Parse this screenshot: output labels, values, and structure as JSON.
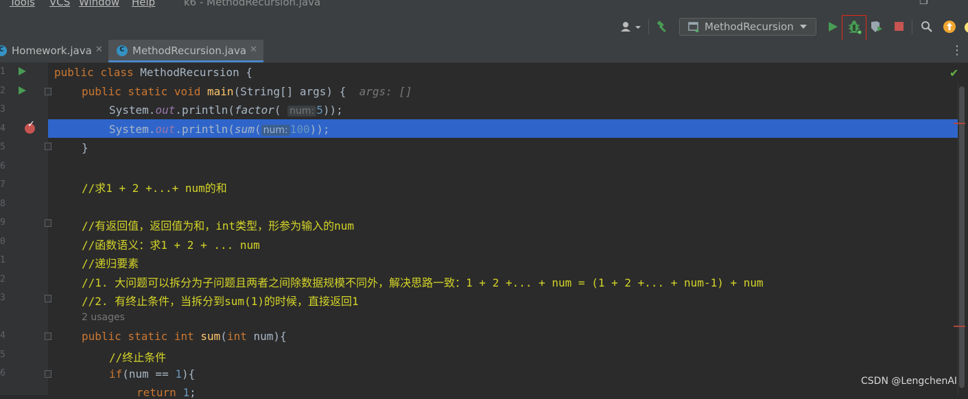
{
  "menubar": {
    "items": [
      "Tools",
      "VCS",
      "Window",
      "Help"
    ],
    "title": "k6 - MethodRecursion.java"
  },
  "toolbar": {
    "run_config": "MethodRecursion",
    "icons": [
      "user-icon",
      "build-hammer-icon",
      "run-icon",
      "debug-icon",
      "coverage-icon",
      "stop-icon",
      "search-icon",
      "update-icon"
    ]
  },
  "tabs": [
    {
      "label": "Homework.java",
      "active": false
    },
    {
      "label": "MethodRecursion.java",
      "active": true
    }
  ],
  "editor": {
    "line_numbers": [
      "1",
      "2",
      "3",
      "4",
      "5",
      "6",
      "7",
      "8",
      "9",
      "0",
      "1",
      "2",
      "3",
      "",
      "4",
      "5",
      "6"
    ],
    "lines": {
      "l1_kw": "public class ",
      "l1_name": "MethodRecursion {",
      "l2_kw": "public static void ",
      "l2_fn": "main",
      "l2_rest": "(String[] args) {",
      "l2_hint": "args: []",
      "l3_a": "System.",
      "l3_out": "out",
      "l3_b": ".println(",
      "l3_fn": "factor",
      "l3_c": "(",
      "l3_hint": "num:",
      "l3_num": "5",
      "l3_d": "));",
      "l4_a": "System.",
      "l4_out": "out",
      "l4_b": ".println(",
      "l4_fn": "sum",
      "l4_c": "(",
      "l4_hint": "num:",
      "l4_num": "100",
      "l4_d": "));",
      "l5": "}",
      "l7": "//求1 + 2 +...+ num的和",
      "l9": "//有返回值，返回值为和，int类型，形参为输入的num",
      "l10": "//函数语义：求1 + 2 + ... num",
      "l11": "//递归要素",
      "l12": "//1. 大问题可以拆分为子问题且两者之间除数据规模不同外，解决思路一致：1 + 2 +... + num = (1 + 2 +... + num-1) + num",
      "l13": "//2. 有终止条件，当拆分到sum(1)的时候，直接返回1",
      "usages": "2 usages",
      "l14_kw": "public static int ",
      "l14_fn": "sum",
      "l14_a": "(",
      "l14_kw2": "int",
      "l14_b": " num){",
      "l15": "//终止条件",
      "l16_kw": "if",
      "l16_a": "(num == ",
      "l16_num": "1",
      "l16_b": "){",
      "l17_kw": "return ",
      "l17_num": "1",
      "l17_b": ";"
    }
  },
  "watermark": "CSDN @LengchenAI",
  "colors": {
    "keyword": "#cc7832",
    "method": "#ffc66d",
    "comment": "#d4d429",
    "number": "#6897bb",
    "static_field": "#9876aa",
    "selection": "#2f65ca"
  }
}
